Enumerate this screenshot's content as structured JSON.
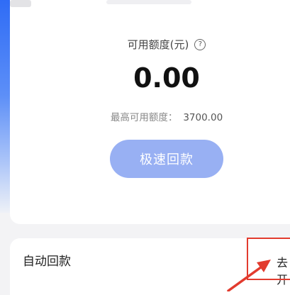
{
  "credit": {
    "available_label": "可用额度(元)",
    "help_icon": "question-circle-icon",
    "help_glyph": "?",
    "amount": "0.00",
    "max_label": "最高可用额度：",
    "max_value": "3700.00",
    "repay_button": "极速回款"
  },
  "auto_repay": {
    "title": "自动回款",
    "action": "去开"
  },
  "colors": {
    "accent": "#98b0f3",
    "highlight": "#e23b2e"
  }
}
